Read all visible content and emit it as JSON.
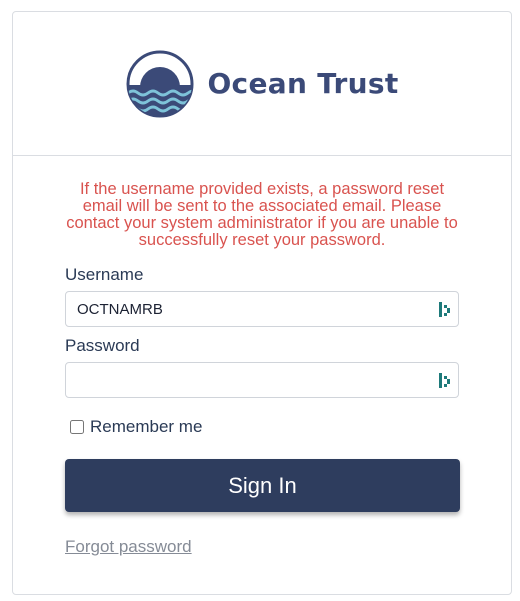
{
  "brand": {
    "name": "Ocean Trust",
    "logo_icon": "ocean-sun-waves-logo",
    "color": "#3b4a78"
  },
  "alert": {
    "text": "If the username provided exists, a password reset email will be sent to the associated email. Please contact your system administrator if you are unable to successfully reset your password.",
    "color": "#d9534f"
  },
  "form": {
    "username_label": "Username",
    "username_value": "OCTNAMRB",
    "password_label": "Password",
    "password_value": "",
    "remember_label": "Remember me",
    "remember_checked": false,
    "field_icon": "password-manager-icon",
    "field_icon_color": "#1e7a7a",
    "signin_label": "Sign In",
    "signin_color": "#2e3d5e",
    "forgot_label": "Forgot password"
  }
}
